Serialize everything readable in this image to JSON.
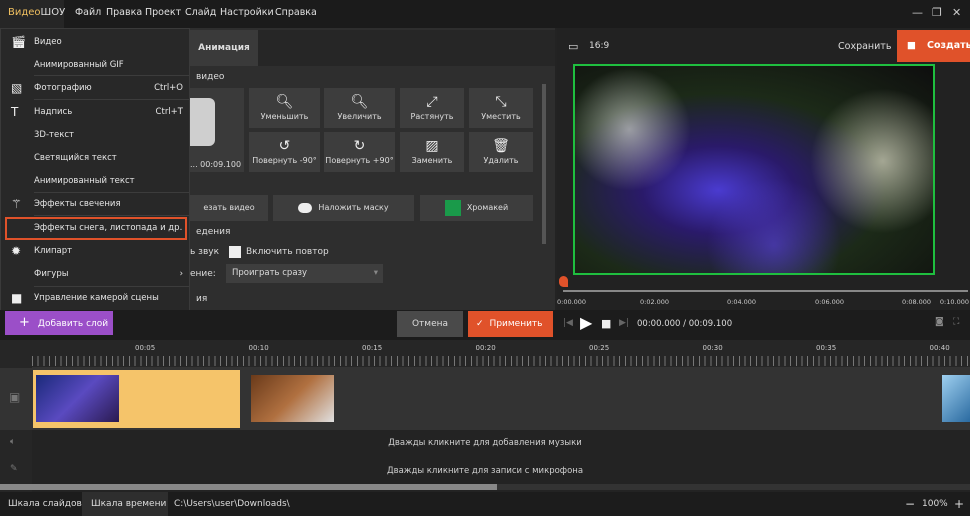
{
  "app": {
    "logo_part1": "Видео",
    "logo_part2": "ШОУ"
  },
  "menubar": [
    "Файл",
    "Правка",
    "Проект",
    "Слайд",
    "Настройки",
    "Справка"
  ],
  "tabs": {
    "animation": "Анимация"
  },
  "panel": {
    "section_video": "видео",
    "duration": "... 00:09.100",
    "grid": [
      {
        "label": "Уменьшить",
        "icon": "zoom-out-icon"
      },
      {
        "label": "Увеличить",
        "icon": "zoom-in-icon"
      },
      {
        "label": "Растянуть",
        "icon": "stretch-icon"
      },
      {
        "label": "Уместить",
        "icon": "fit-icon"
      },
      {
        "label": "Повернуть -90°",
        "icon": "rotate-left-icon"
      },
      {
        "label": "Повернуть +90°",
        "icon": "rotate-right-icon"
      },
      {
        "label": "Заменить",
        "icon": "replace-icon"
      },
      {
        "label": "Удалить",
        "icon": "trash-icon"
      }
    ],
    "crop_video": "езать видео",
    "mask": "Наложить маску",
    "chroma": "Хромакей",
    "section_playback": "едения",
    "sound_label": "ь звук",
    "repeat_label": "Включить повтор",
    "play_label": "ение:",
    "play_select": "Проиграть сразу",
    "section_bottom": "ия"
  },
  "menu": [
    {
      "label": "Видео",
      "icon": "film-icon",
      "shortcut": ""
    },
    {
      "label": "Анимированный GIF",
      "icon": "",
      "shortcut": ""
    },
    {
      "label": "Фотографию",
      "icon": "image-icon",
      "shortcut": "Ctrl+O"
    },
    {
      "label": "Надпись",
      "icon": "text-icon",
      "shortcut": "Ctrl+T"
    },
    {
      "label": "3D-текст",
      "icon": "",
      "shortcut": ""
    },
    {
      "label": "Светящийся текст",
      "icon": "",
      "shortcut": ""
    },
    {
      "label": "Анимированный текст",
      "icon": "",
      "shortcut": ""
    },
    {
      "label": "Эффекты свечения",
      "icon": "magic-wand-icon",
      "shortcut": ""
    },
    {
      "label": "Эффекты снега, листопада и др.",
      "icon": "",
      "shortcut": "",
      "highlighted": true
    },
    {
      "label": "Клипарт",
      "icon": "gear-icon",
      "shortcut": ""
    },
    {
      "label": "Фигуры",
      "icon": "",
      "shortcut": "",
      "submenu": true
    },
    {
      "label": "Управление камерой сцены",
      "icon": "camera-icon",
      "shortcut": ""
    }
  ],
  "preview": {
    "aspect": "16:9",
    "save": "Сохранить",
    "create": "Создать",
    "scrub_ticks": [
      "0:00.000",
      "0:02.000",
      "0:04.000",
      "0:06.000",
      "0:08.000",
      "0:10.000"
    ],
    "time": "00:00.000 / 00:09.100"
  },
  "controls": {
    "add_layer": "Добавить слой",
    "cancel": "Отмена",
    "apply": "Применить"
  },
  "timeline": {
    "ticks": [
      "00:05",
      "00:10",
      "00:15",
      "00:20",
      "00:25",
      "00:30",
      "00:35",
      "00:40"
    ],
    "music_hint": "Дважды кликните для добавления музыки",
    "mic_hint": "Дважды кликните для записи с микрофона"
  },
  "status": {
    "slides_tab": "Шкала слайдов",
    "timeline_tab": "Шкала времени",
    "path": "C:\\Users\\user\\Downloads\\",
    "zoom": "100%"
  },
  "colors": {
    "accent_orange": "#e0522a",
    "purple": "#9b4fc8",
    "chroma_green": "#1a9a4a",
    "clip_yellow": "#f5c46a",
    "frame_green": "#1fbf3f"
  }
}
